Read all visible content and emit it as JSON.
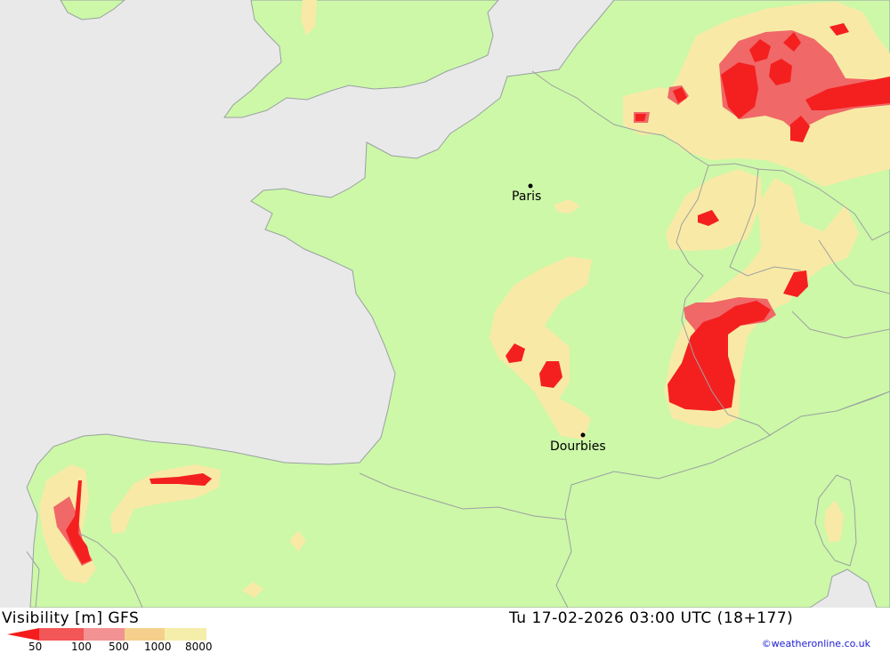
{
  "map": {
    "cities": [
      {
        "name": "Paris",
        "id": "paris"
      },
      {
        "name": "Dourbies",
        "id": "dourbies"
      }
    ]
  },
  "footer": {
    "title": "Visibility [m] GFS",
    "datetime": "Tu 17-02-2026 03:00 UTC (18+177)",
    "credit": "©weatheronline.co.uk"
  },
  "legend": {
    "labels": [
      "50",
      "100",
      "500",
      "1000",
      "8000"
    ],
    "colors": [
      "#f41c1c",
      "#f25656",
      "#f29292",
      "#f5d08c",
      "#f5eeaa"
    ]
  },
  "colors": {
    "sea": "#e9e9e9",
    "land": "#ccf8a8",
    "very_low": "#f42020",
    "low": "#f06868",
    "medium": "#f8eaa6"
  }
}
